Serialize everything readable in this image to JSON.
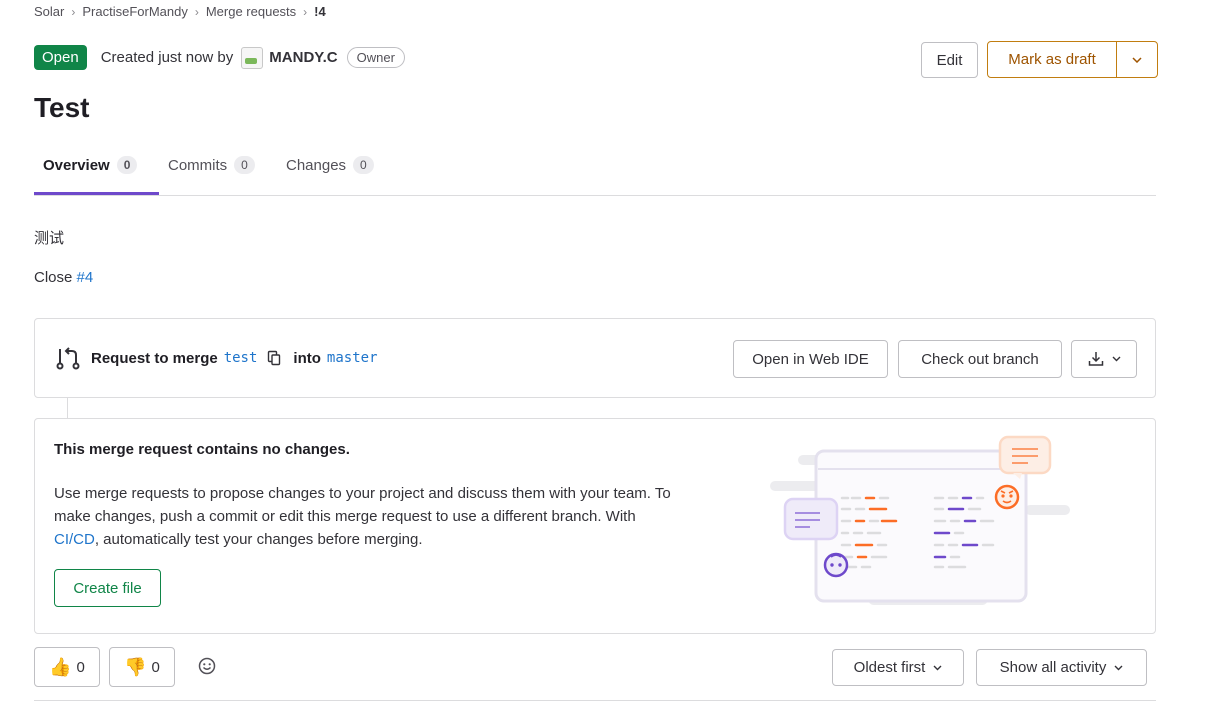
{
  "breadcrumb": [
    "Solar",
    "PractiseForMandy",
    "Merge requests",
    "!4"
  ],
  "status_badge": "Open",
  "created_text": "Created just now by",
  "author": "MANDY.C",
  "author_role": "Owner",
  "buttons": {
    "edit": "Edit",
    "mark_as_draft": "Mark as draft"
  },
  "title": "Test",
  "tabs": [
    {
      "label": "Overview",
      "count": "0",
      "active": true
    },
    {
      "label": "Commits",
      "count": "0",
      "active": false
    },
    {
      "label": "Changes",
      "count": "0",
      "active": false
    }
  ],
  "description": {
    "line1": "测试",
    "close_prefix": "Close",
    "issue_ref": "#4"
  },
  "merge_info": {
    "request_label": "Request to merge",
    "source_branch": "test",
    "into_label": "into",
    "target_branch": "master",
    "web_ide_button": "Open in Web IDE",
    "checkout_button": "Check out branch"
  },
  "empty_state": {
    "title": "This merge request contains no changes.",
    "body_before_link": "Use merge requests to propose changes to your project and discuss them with your team. To make changes, push a commit or edit this merge request to use a different branch. With ",
    "link_text": "CI/CD",
    "body_after_link": ", automatically test your changes before merging.",
    "create_file_button": "Create file"
  },
  "reactions": {
    "thumbs_up_count": "0",
    "thumbs_down_count": "0"
  },
  "sort_button": "Oldest first",
  "activity_button": "Show all activity",
  "colors": {
    "accent_purple": "#6e49cb",
    "open_green": "#108548",
    "draft_orange": "#c17d10",
    "link_blue": "#1f75cb"
  }
}
